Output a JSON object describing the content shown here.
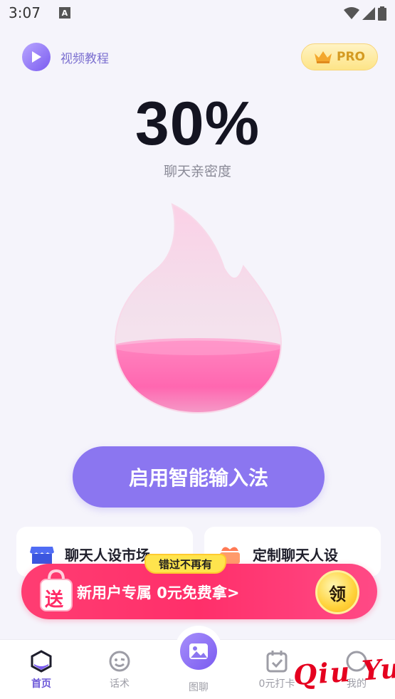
{
  "status_bar": {
    "time": "3:07",
    "notif_badge": "A"
  },
  "header": {
    "video_tutorial_label": "视频教程",
    "pro_label": "PRO"
  },
  "intimacy": {
    "percent_text": "30%",
    "percent_value": 30,
    "label": "聊天亲密度"
  },
  "enable_button_label": "启用智能输入法",
  "cards": [
    {
      "label": "聊天人设市场",
      "icon": "shop-icon"
    },
    {
      "label": "定制聊天人设",
      "icon": "gift-hand-icon"
    }
  ],
  "promo": {
    "tag": "错过不再有",
    "gift_badge": "送",
    "text": "新用户专属 0元免费拿>",
    "claim_label": "领"
  },
  "bottom_nav": [
    {
      "label": "首页",
      "icon": "home-icon",
      "active": true
    },
    {
      "label": "话术",
      "icon": "chat-face-icon",
      "active": false
    },
    {
      "label": "图聊",
      "icon": "image-icon",
      "active": false
    },
    {
      "label": "0元打卡",
      "icon": "calendar-check-icon",
      "active": false
    },
    {
      "label": "我的",
      "icon": "profile-icon",
      "active": false
    }
  ],
  "watermark": "Qiu Yue",
  "colors": {
    "accent": "#8b76f0",
    "promo": "#ff2f6a",
    "pro_gold": "#fde487"
  }
}
